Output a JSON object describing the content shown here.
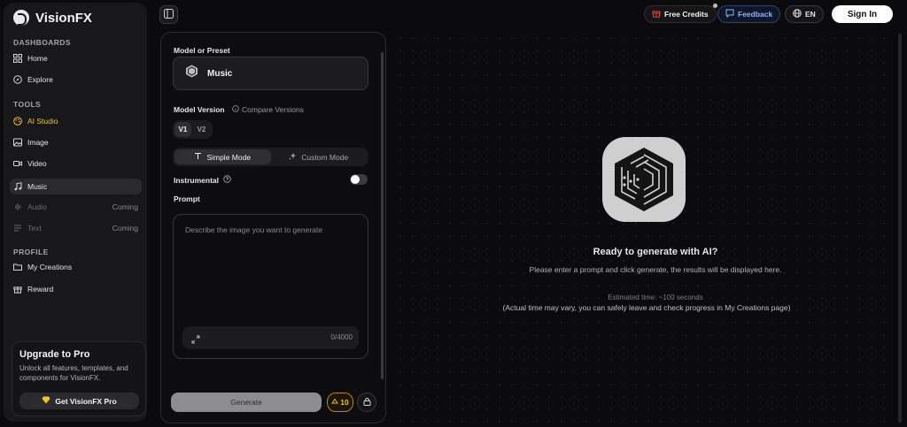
{
  "brand": {
    "name": "VisionFX"
  },
  "sidebar": {
    "dashboards_label": "DASHBOARDS",
    "tools_label": "TOOLS",
    "profile_label": "PROFILE",
    "items": [
      {
        "label": "Home"
      },
      {
        "label": "Explore"
      },
      {
        "label": "AI Studio"
      },
      {
        "label": "Image"
      },
      {
        "label": "Video"
      },
      {
        "label": "Music"
      },
      {
        "label": "Audio",
        "badge": "Coming"
      },
      {
        "label": "Text",
        "badge": "Coming"
      },
      {
        "label": "My Creations"
      },
      {
        "label": "Reward"
      }
    ],
    "upgrade": {
      "title": "Upgrade to Pro",
      "description": "Unlock all features, templates, and components for VisionFX.",
      "button": "Get VisionFX Pro"
    }
  },
  "topbar": {
    "free_credits": "Free Credits",
    "feedback": "Feedback",
    "language": "EN",
    "sign_in": "Sign In"
  },
  "panel": {
    "model_label": "Model or Preset",
    "preset": "Music",
    "version_label": "Model Version",
    "compare": "Compare Versions",
    "versions": [
      "V1",
      "V2"
    ],
    "selected_version": "V1",
    "modes": [
      "Simple Mode",
      "Custom Mode"
    ],
    "selected_mode": "Simple Mode",
    "instrumental_label": "Instrumental",
    "instrumental_on": false,
    "prompt_label": "Prompt",
    "prompt_placeholder": "Describe the image you want to generate",
    "char_count": "0/4000",
    "generate": "Generate",
    "cost": "10"
  },
  "main": {
    "ready": "Ready to generate with AI?",
    "description": "Please enter a prompt and click generate, the results will be displayed here.",
    "estimate": "Estimated time: ~100 seconds",
    "note": "(Actual time may vary, you can safely leave and check progress in My Creations page)"
  },
  "colors": {
    "accent": "#f5c518",
    "feedback": "#8fb3ff",
    "background": "#0b0b0d"
  }
}
